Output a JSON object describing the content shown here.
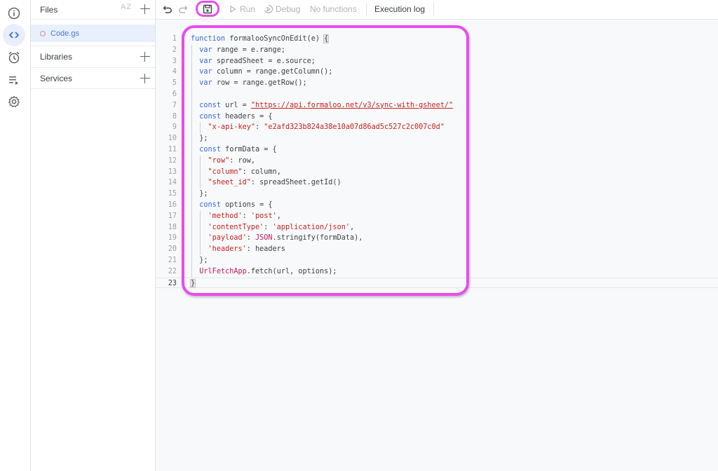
{
  "rail": {
    "items": [
      {
        "name": "overview",
        "icon": "info-icon",
        "active": false
      },
      {
        "name": "editor",
        "icon": "code-icon",
        "active": true
      },
      {
        "name": "triggers",
        "icon": "alarm-clock-icon",
        "active": false
      },
      {
        "name": "executions",
        "icon": "executions-list-icon",
        "active": false
      },
      {
        "name": "project-settings",
        "icon": "gear-icon",
        "active": false
      }
    ]
  },
  "files_panel": {
    "title": "Files",
    "sort_label": "AZ",
    "files": [
      {
        "name": "Code.gs",
        "active": true
      }
    ],
    "sections": [
      {
        "label": "Libraries"
      },
      {
        "label": "Services"
      }
    ]
  },
  "toolbar": {
    "undo": "undo-icon",
    "redo": "redo-icon",
    "save": "save-icon",
    "run_label": "Run",
    "debug_label": "Debug",
    "function_select": "No functions",
    "execution_log_label": "Execution log"
  },
  "editor": {
    "current_line": 23,
    "lines": [
      "function formalooSyncOnEdit(e) {",
      "  var range = e.range;",
      "  var spreadSheet = e.source;",
      "  var column = range.getColumn();",
      "  var row = range.getRow();",
      "",
      "  const url = \"https://api.formaloo.net/v3/sync-with-gsheet/\"",
      "  const headers = {",
      "    \"x-api-key\": \"e2afd323b824a38e10a07d86ad5c527c2c007c0d\"",
      "  };",
      "  const formData = {",
      "    \"row\": row,",
      "    \"column\": column,",
      "    \"sheet_id\": spreadSheet.getId()",
      "  };",
      "  const options = {",
      "    'method': 'post',",
      "    'contentType': 'application/json',",
      "    'payload': JSON.stringify(formData),",
      "    'headers': headers",
      "  };",
      "  UrlFetchApp.fetch(url, options);",
      "}"
    ]
  },
  "annotation": {
    "color": "#e94cf0"
  }
}
